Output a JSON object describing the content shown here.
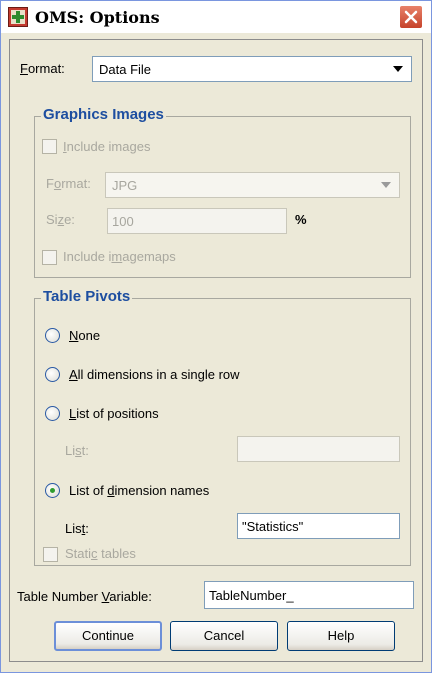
{
  "window": {
    "title": "OMS: Options"
  },
  "format": {
    "label_prefix": "",
    "label_u": "F",
    "label_rest": "ormat:",
    "value": "Data File"
  },
  "graphics": {
    "title": "Graphics Images",
    "include_images": {
      "u": "I",
      "rest": "nclude images"
    },
    "format_label": {
      "pre": "F",
      "u": "o",
      "rest": "rmat:"
    },
    "format_value": "JPG",
    "size_label": {
      "pre": "Si",
      "u": "z",
      "rest": "e:"
    },
    "size_value": "100",
    "size_unit": "%",
    "imagemaps": {
      "pre": "Include i",
      "u": "m",
      "rest": "agemaps"
    }
  },
  "pivots": {
    "title": "Table Pivots",
    "none": {
      "u": "N",
      "rest": "one"
    },
    "all_dims": {
      "u": "A",
      "rest": "ll dimensions in a single row"
    },
    "list_positions": {
      "u": "L",
      "rest": "ist of positions"
    },
    "list_label_1": {
      "pre": "Li",
      "u": "s",
      "rest": "t:"
    },
    "list_dim_names": {
      "pre": "List of ",
      "u": "d",
      "rest": "imension names"
    },
    "list_label_2": {
      "pre": "Lis",
      "u": "t",
      "rest": ":"
    },
    "list_value": "\"Statistics\"",
    "static_tables": {
      "pre": "Stati",
      "u": "c",
      "rest": " tables"
    }
  },
  "table_number": {
    "pre": "Table Number ",
    "u": "V",
    "rest": "ariable:",
    "value": "TableNumber_"
  },
  "buttons": {
    "continue": "Continue",
    "cancel": "Cancel",
    "help": "Help"
  }
}
